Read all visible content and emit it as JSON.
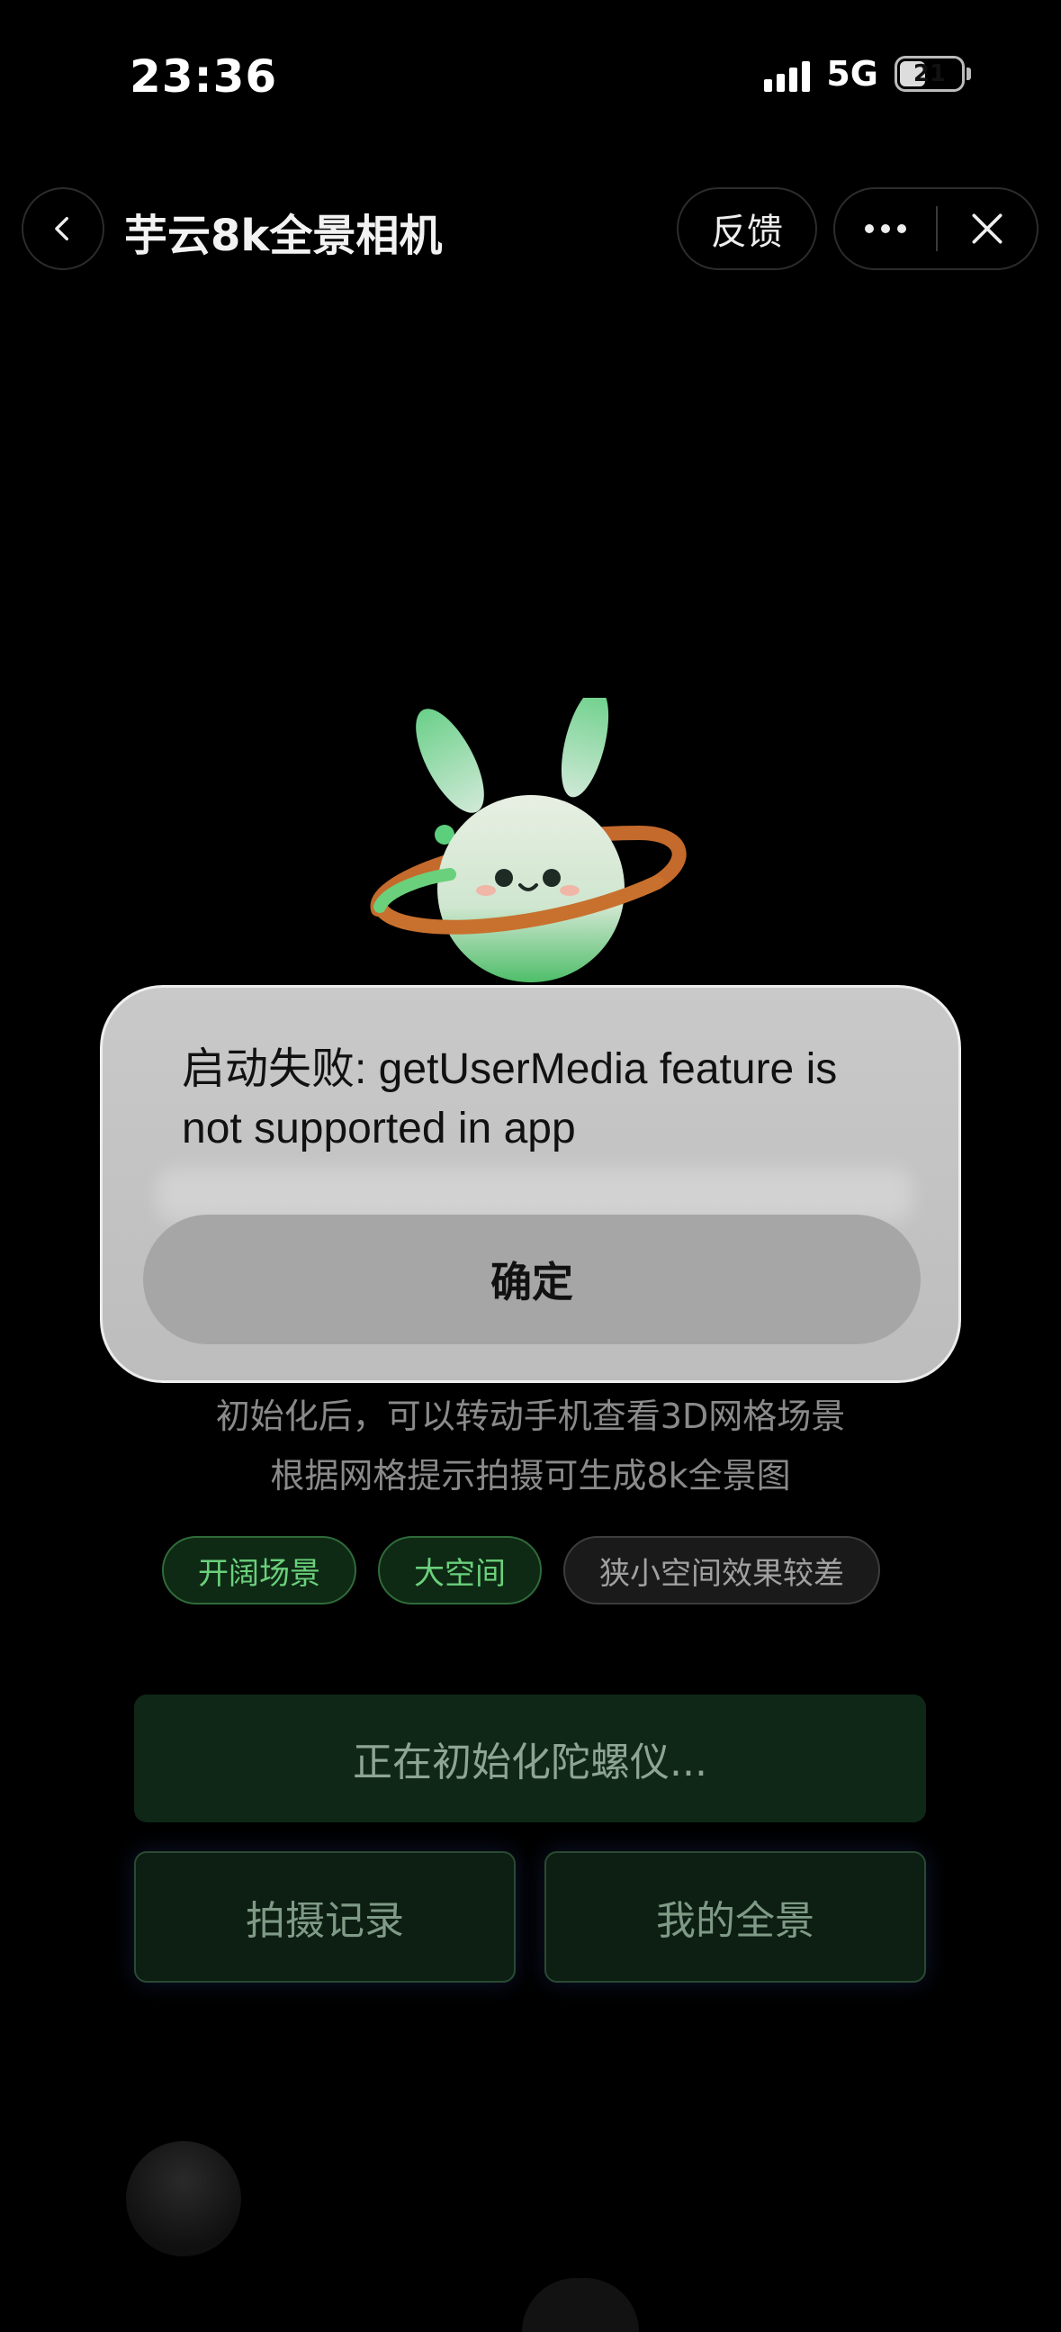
{
  "status": {
    "time": "23:36",
    "network": "5G",
    "battery": "21"
  },
  "nav": {
    "title": "芋云8k全景相机",
    "feedback": "反馈"
  },
  "info": {
    "line1": "初始化后，可以转动手机查看3D网格场景",
    "line2": "根据网格提示拍摄可生成8k全景图"
  },
  "chips": [
    "开阔场景",
    "大空间",
    "狭小空间效果较差"
  ],
  "actions": {
    "primary": "正在初始化陀螺仪...",
    "records": "拍摄记录",
    "mine": "我的全景"
  },
  "dialog": {
    "message": "启动失败: getUserMedia feature is not supported in app",
    "confirm": "确定"
  },
  "colors": {
    "accent_green": "#6ad07c",
    "button_bg": "#0f2716",
    "dialog_bg": "#c4c4c4"
  }
}
